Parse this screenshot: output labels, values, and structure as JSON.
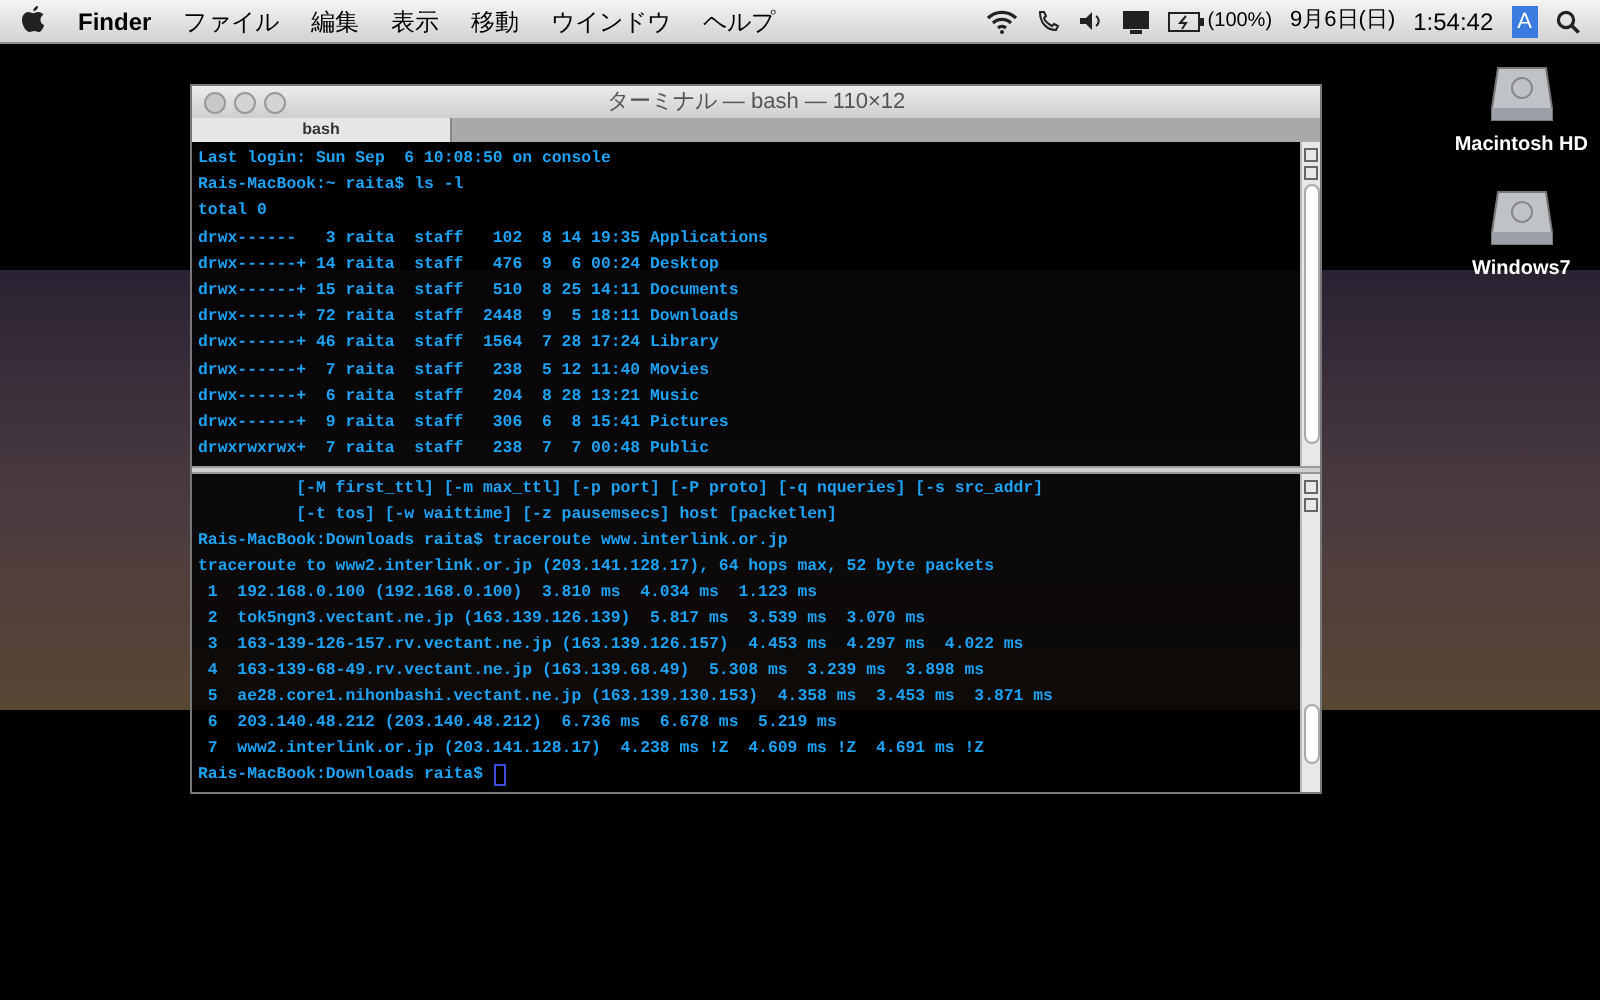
{
  "menu_bar": {
    "app": "Finder",
    "menus": [
      "ファイル",
      "編集",
      "表示",
      "移動",
      "ウインドウ",
      "ヘルプ"
    ],
    "battery": "(100%)",
    "date": "9月6日(日)",
    "time": "1:54:42",
    "input_method": "A"
  },
  "desktop_icons": [
    {
      "label": "Macintosh HD"
    },
    {
      "label": "Windows7"
    }
  ],
  "terminal": {
    "title": "ターミナル — bash — 110×12",
    "tabs": [
      {
        "label": "bash",
        "selected": true
      }
    ],
    "top_pane": [
      "Last login: Sun Sep  6 10:08:50 on console",
      "Rais-MacBook:~ raita$ ls -l",
      "total 0",
      "drwx------   3 raita  staff   102  8 14 19:35 Applications",
      "drwx------+ 14 raita  staff   476  9  6 00:24 Desktop",
      "drwx------+ 15 raita  staff   510  8 25 14:11 Documents",
      "drwx------+ 72 raita  staff  2448  9  5 18:11 Downloads",
      "drwx------+ 46 raita  staff  1564  7 28 17:24 Library",
      "drwx------+  7 raita  staff   238  5 12 11:40 Movies",
      "drwx------+  6 raita  staff   204  8 28 13:21 Music",
      "drwx------+  9 raita  staff   306  6  8 15:41 Pictures",
      "drwxrwxrwx+  7 raita  staff   238  7  7 00:48 Public"
    ],
    "bottom_pane": [
      "          [-M first_ttl] [-m max_ttl] [-p port] [-P proto] [-q nqueries] [-s src_addr]",
      "          [-t tos] [-w waittime] [-z pausemsecs] host [packetlen]",
      "Rais-MacBook:Downloads raita$ traceroute www.interlink.or.jp",
      "traceroute to www2.interlink.or.jp (203.141.128.17), 64 hops max, 52 byte packets",
      " 1  192.168.0.100 (192.168.0.100)  3.810 ms  4.034 ms  1.123 ms",
      " 2  tok5ngn3.vectant.ne.jp (163.139.126.139)  5.817 ms  3.539 ms  3.070 ms",
      " 3  163-139-126-157.rv.vectant.ne.jp (163.139.126.157)  4.453 ms  4.297 ms  4.022 ms",
      " 4  163-139-68-49.rv.vectant.ne.jp (163.139.68.49)  5.308 ms  3.239 ms  3.898 ms",
      " 5  ae28.core1.nihonbashi.vectant.ne.jp (163.139.130.153)  4.358 ms  3.453 ms  3.871 ms",
      " 6  203.140.48.212 (203.140.48.212)  6.736 ms  6.678 ms  5.219 ms",
      " 7  www2.interlink.or.jp (203.141.128.17)  4.238 ms !Z  4.609 ms !Z  4.691 ms !Z",
      "Rais-MacBook:Downloads raita$"
    ]
  }
}
